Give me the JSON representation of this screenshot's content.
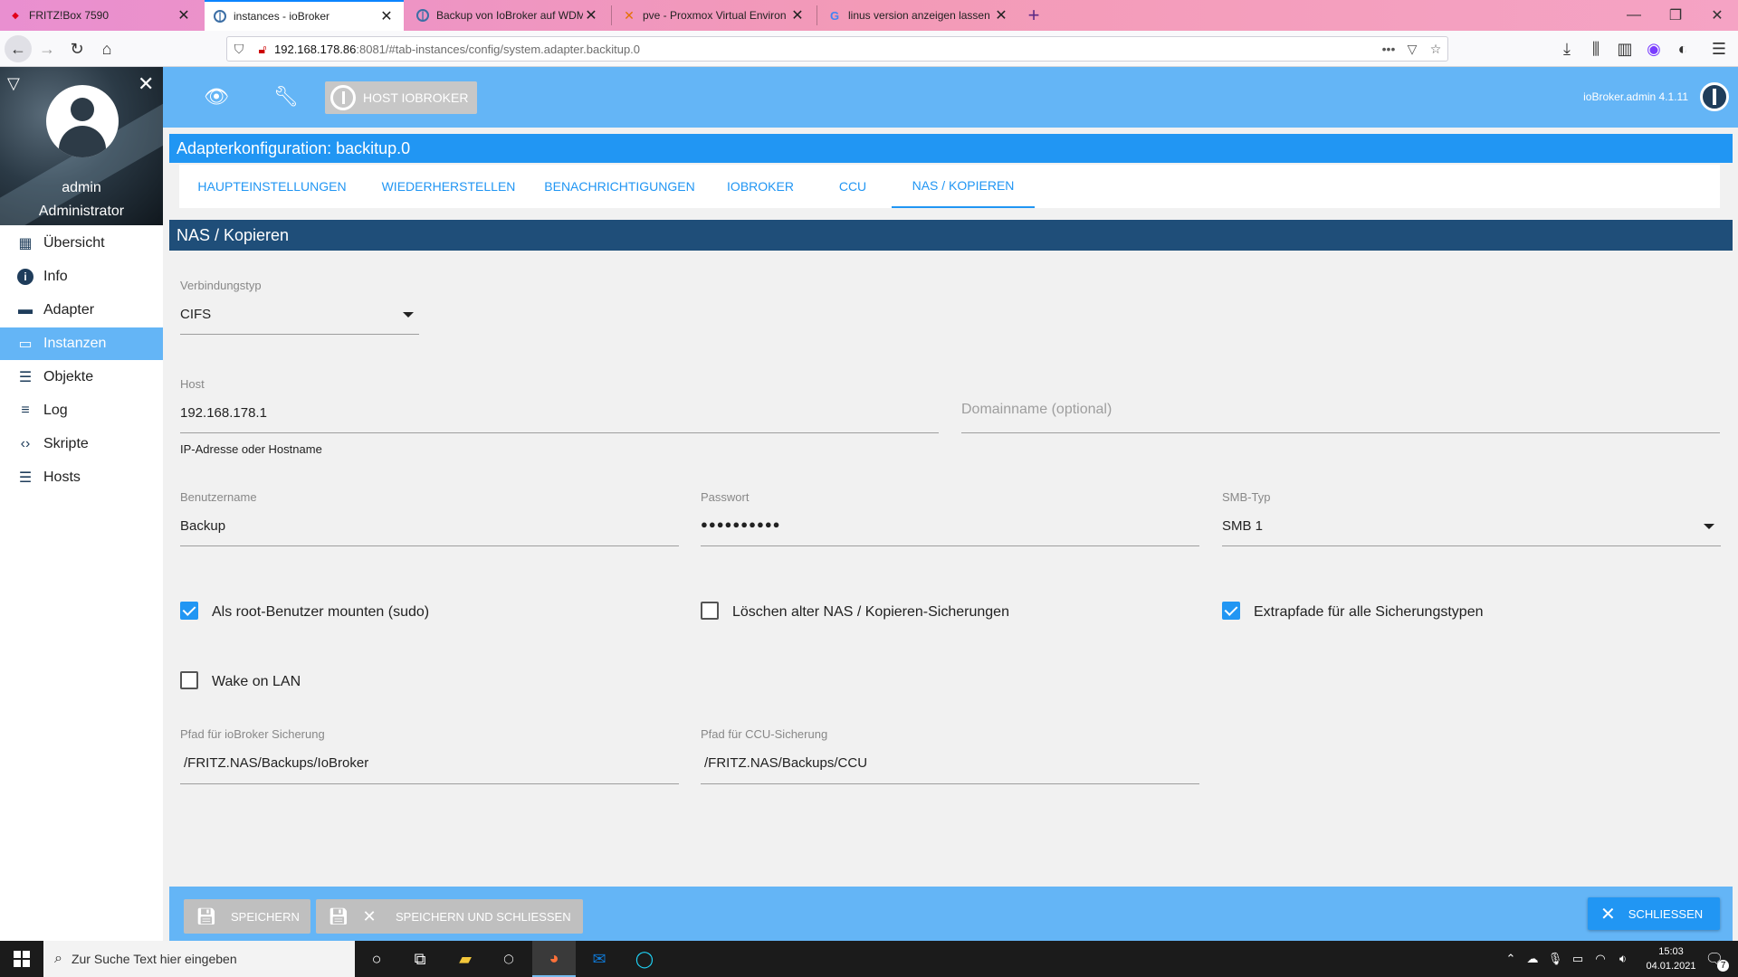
{
  "browser": {
    "tabs": [
      {
        "title": "FRITZ!Box 7590",
        "icon": "fritzbox-favicon",
        "active": false
      },
      {
        "title": "instances - ioBroker",
        "icon": "iobroker-favicon",
        "active": true
      },
      {
        "title": "Backup von IoBroker auf WDM",
        "icon": "iobroker-favicon",
        "active": false
      },
      {
        "title": "pve - Proxmox Virtual Environ",
        "icon": "proxmox-favicon",
        "active": false
      },
      {
        "title": "linus version anzeigen lassen -",
        "icon": "google-favicon",
        "active": false
      }
    ],
    "url_host": "192.168.178.86",
    "url_rest": ":8081/#tab-instances/config/system.adapter.backitup.0"
  },
  "sidebar": {
    "user_name": "admin",
    "user_role": "Administrator",
    "items": [
      {
        "label": "Übersicht",
        "icon": "grid-icon",
        "glyph": "▦",
        "active": false
      },
      {
        "label": "Info",
        "icon": "info-icon",
        "glyph": "ℹ",
        "active": false
      },
      {
        "label": "Adapter",
        "icon": "store-icon",
        "glyph": "▬",
        "active": false
      },
      {
        "label": "Instanzen",
        "icon": "instances-icon",
        "glyph": "▭",
        "active": true
      },
      {
        "label": "Objekte",
        "icon": "list-icon",
        "glyph": "☰",
        "active": false
      },
      {
        "label": "Log",
        "icon": "log-icon",
        "glyph": "≡",
        "active": false
      },
      {
        "label": "Skripte",
        "icon": "code-icon",
        "glyph": "‹›",
        "active": false
      },
      {
        "label": "Hosts",
        "icon": "hosts-icon",
        "glyph": "☰",
        "active": false
      }
    ]
  },
  "header": {
    "host_button": "HOST IOBROKER",
    "version": "ioBroker.admin 4.1.11"
  },
  "config": {
    "title": "Adapterkonfiguration: backitup.0",
    "tabs": [
      "HAUPTEINSTELLUNGEN",
      "WIEDERHERSTELLEN",
      "BENACHRICHTIGUNGEN",
      "IOBROKER",
      "CCU",
      "NAS / KOPIEREN"
    ],
    "active_tab": "NAS / KOPIEREN",
    "section_title": "NAS / Kopieren",
    "connection_type_label": "Verbindungstyp",
    "connection_type_value": "CIFS",
    "host_label": "Host",
    "host_value": "192.168.178.1",
    "host_hint": "IP-Adresse oder Hostname",
    "domain_placeholder": "Domainname (optional)",
    "username_label": "Benutzername",
    "username_value": "Backup",
    "password_label": "Passwort",
    "password_value": "●●●●●●●●●●",
    "smb_label": "SMB-Typ",
    "smb_value": "SMB 1",
    "checkboxes": [
      {
        "label": "Als root-Benutzer mounten (sudo)",
        "checked": true
      },
      {
        "label": "Löschen alter NAS / Kopieren-Sicherungen",
        "checked": false
      },
      {
        "label": "Extrapfade für alle Sicherungstypen",
        "checked": true
      },
      {
        "label": "Wake on LAN",
        "checked": false
      }
    ],
    "iobroker_path_label": "Pfad für ioBroker Sicherung",
    "iobroker_path_value": "/FRITZ.NAS/Backups/IoBroker",
    "ccu_path_label": "Pfad für CCU-Sicherung",
    "ccu_path_value": "/FRITZ.NAS/Backups/CCU"
  },
  "footer": {
    "save_label": "SPEICHERN",
    "save_close_label": "SPEICHERN UND SCHLIESSEN",
    "close_label": "SCHLIESSEN"
  },
  "taskbar": {
    "search_placeholder": "Zur Suche Text hier eingeben",
    "time": "15:03",
    "date": "04.01.2021",
    "notification_count": "7"
  },
  "colors": {
    "header_blue": "#64b5f6",
    "accent_blue": "#2196f3",
    "section_dark_blue": "#1f4e79"
  }
}
